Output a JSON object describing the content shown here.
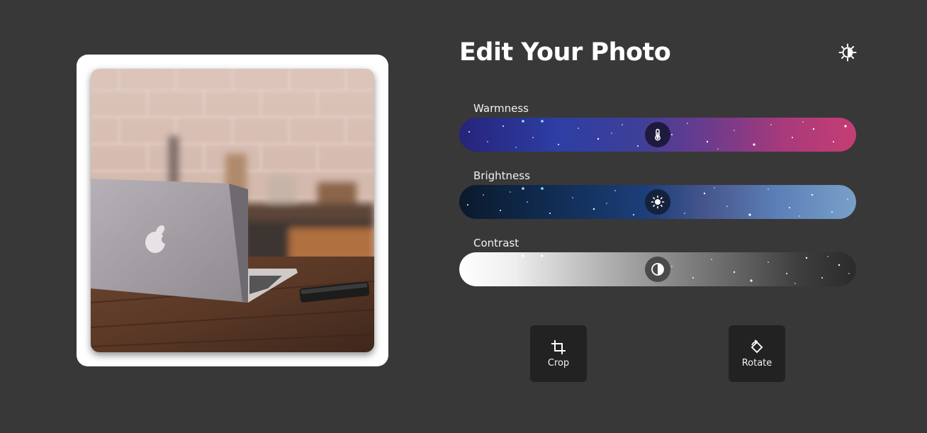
{
  "header": {
    "title": "Edit Your Photo",
    "theme_icon": "sun-half-icon"
  },
  "photo": {
    "alt": "Laptop on a wooden desk",
    "frame_color": "#ffffff"
  },
  "sliders": [
    {
      "label": "Warmness",
      "icon": "thermometer-icon",
      "value": 0.5
    },
    {
      "label": "Brightness",
      "icon": "sun-icon",
      "value": 0.5
    },
    {
      "label": "Contrast",
      "icon": "contrast-icon",
      "value": 0.5
    }
  ],
  "actions": {
    "crop_label": "Crop",
    "crop_icon": "crop-icon",
    "rotate_label": "Rotate",
    "rotate_icon": "rotate-icon"
  },
  "colors": {
    "background": "#383838",
    "button_bg": "#222222",
    "text": "#ffffff"
  }
}
